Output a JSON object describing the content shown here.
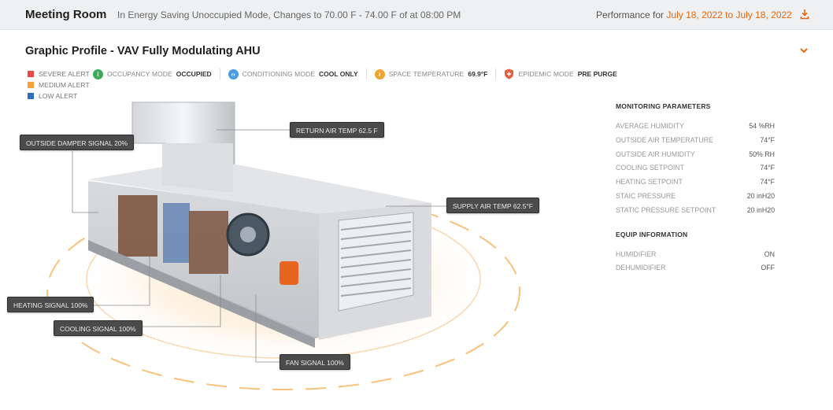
{
  "header": {
    "room_title": "Meeting Room",
    "mode_text": "In Energy Saving Unoccupied Mode, Changes  to 70.00 F - 74.00 F of at 08:00 PM",
    "performance_label": "Performance for",
    "date_range": "July 18, 2022 to July 18, 2022",
    "download_icon": "download-icon"
  },
  "section": {
    "title": "Graphic Profile - VAV Fully Modulating AHU",
    "collapse_icon": "chevron-down-icon"
  },
  "legend": [
    {
      "label": "SEVERE ALERT",
      "color": "#e84848"
    },
    {
      "label": "MEDIUM ALERT",
      "color": "#f5a03a"
    },
    {
      "label": "LOW ALERT",
      "color": "#2f6fc0"
    }
  ],
  "status": [
    {
      "label": "OCCUPANCY MODE",
      "value": "OCCUPIED",
      "color": "#3dab5a",
      "icon": "occupancy-icon"
    },
    {
      "label": "CONDITIONING MODE",
      "value": "COOL ONLY",
      "color": "#4a9be0",
      "icon": "conditioning-icon"
    },
    {
      "label": "SPACE TEMPERATURE",
      "value": "69.9°F",
      "color": "#f3a532",
      "icon": "thermometer-icon"
    },
    {
      "label": "EPIDEMIC MODE",
      "value": "PRE PURGE",
      "color": "#e8603b",
      "icon": "shield-icon"
    }
  ],
  "callouts": {
    "outside_damper": "OUTSIDE DAMPER SIGNAL  20%",
    "return_air": "RETURN AIR TEMP  62.5 F",
    "supply_air": "SUPPLY AIR TEMP   62.5°F",
    "heating": "HEATING SIGNAL  100%",
    "cooling": "COOLING SIGNAL 100%",
    "fan": "FAN SIGNAL  100%"
  },
  "monitoring": {
    "title": "MONITORING PARAMETERS",
    "rows": [
      {
        "label": "AVERAGE HUMIDITY",
        "value": "54 %RH"
      },
      {
        "label": "OUTSIDE AIR TEMPERATURE",
        "value": "74°F"
      },
      {
        "label": "OUTSIDE AIR HUMIDITY",
        "value": "50% RH"
      },
      {
        "label": "COOLING SETPOINT",
        "value": "74°F"
      },
      {
        "label": "HEATING SETPOINT",
        "value": "74°F"
      },
      {
        "label": "STAIC PRESSURE",
        "value": "20 inH20"
      },
      {
        "label": "STATIC PRESSURE SETPOINT",
        "value": "20 inH20"
      }
    ]
  },
  "equip": {
    "title": "EQUIP INFORMATION",
    "rows": [
      {
        "label": "HUMIDIFIER",
        "value": "ON"
      },
      {
        "label": "DEHUMIDIFIER",
        "value": "OFF"
      }
    ]
  },
  "colors": {
    "accent": "#e8660d",
    "glow": "#f7b15a"
  }
}
